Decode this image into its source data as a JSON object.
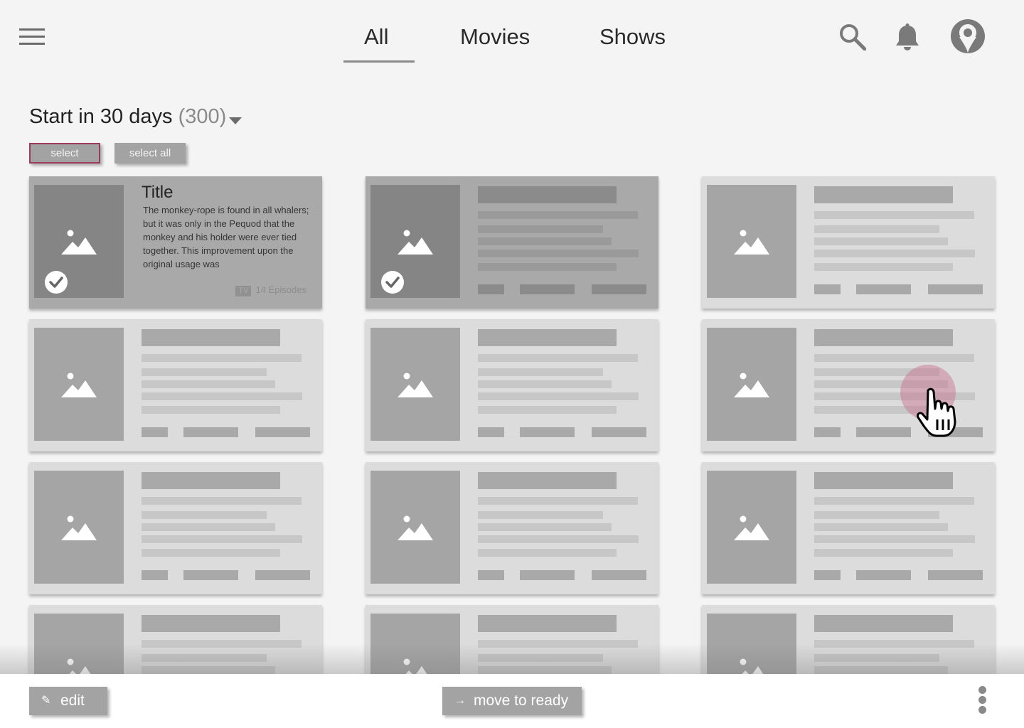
{
  "nav": {
    "tabs": [
      {
        "label": "All"
      },
      {
        "label": "Movies"
      },
      {
        "label": "Shows"
      }
    ],
    "icons": [
      "menu-icon",
      "search-icon",
      "bell-icon",
      "avatar-icon"
    ]
  },
  "section": {
    "title": "Start in 30 days",
    "count": "(300)"
  },
  "actions": {
    "select_label": "select",
    "select_all_label": "select all"
  },
  "first_card": {
    "title": "Title",
    "description": "The monkey-rope is found in all whalers; but it was only in the Pequod that the monkey and his holder were ever tied together. This improvement upon the original usage was",
    "type_badge": "TV",
    "episodes": "14 Episodes"
  },
  "bottom_bar": {
    "edit_label": "edit",
    "move_label": "move to ready"
  },
  "colors": {
    "accent_border": "#9b3a5c",
    "button_gray": "#a3a3a3",
    "cursor_halo": "#c86e8c"
  }
}
